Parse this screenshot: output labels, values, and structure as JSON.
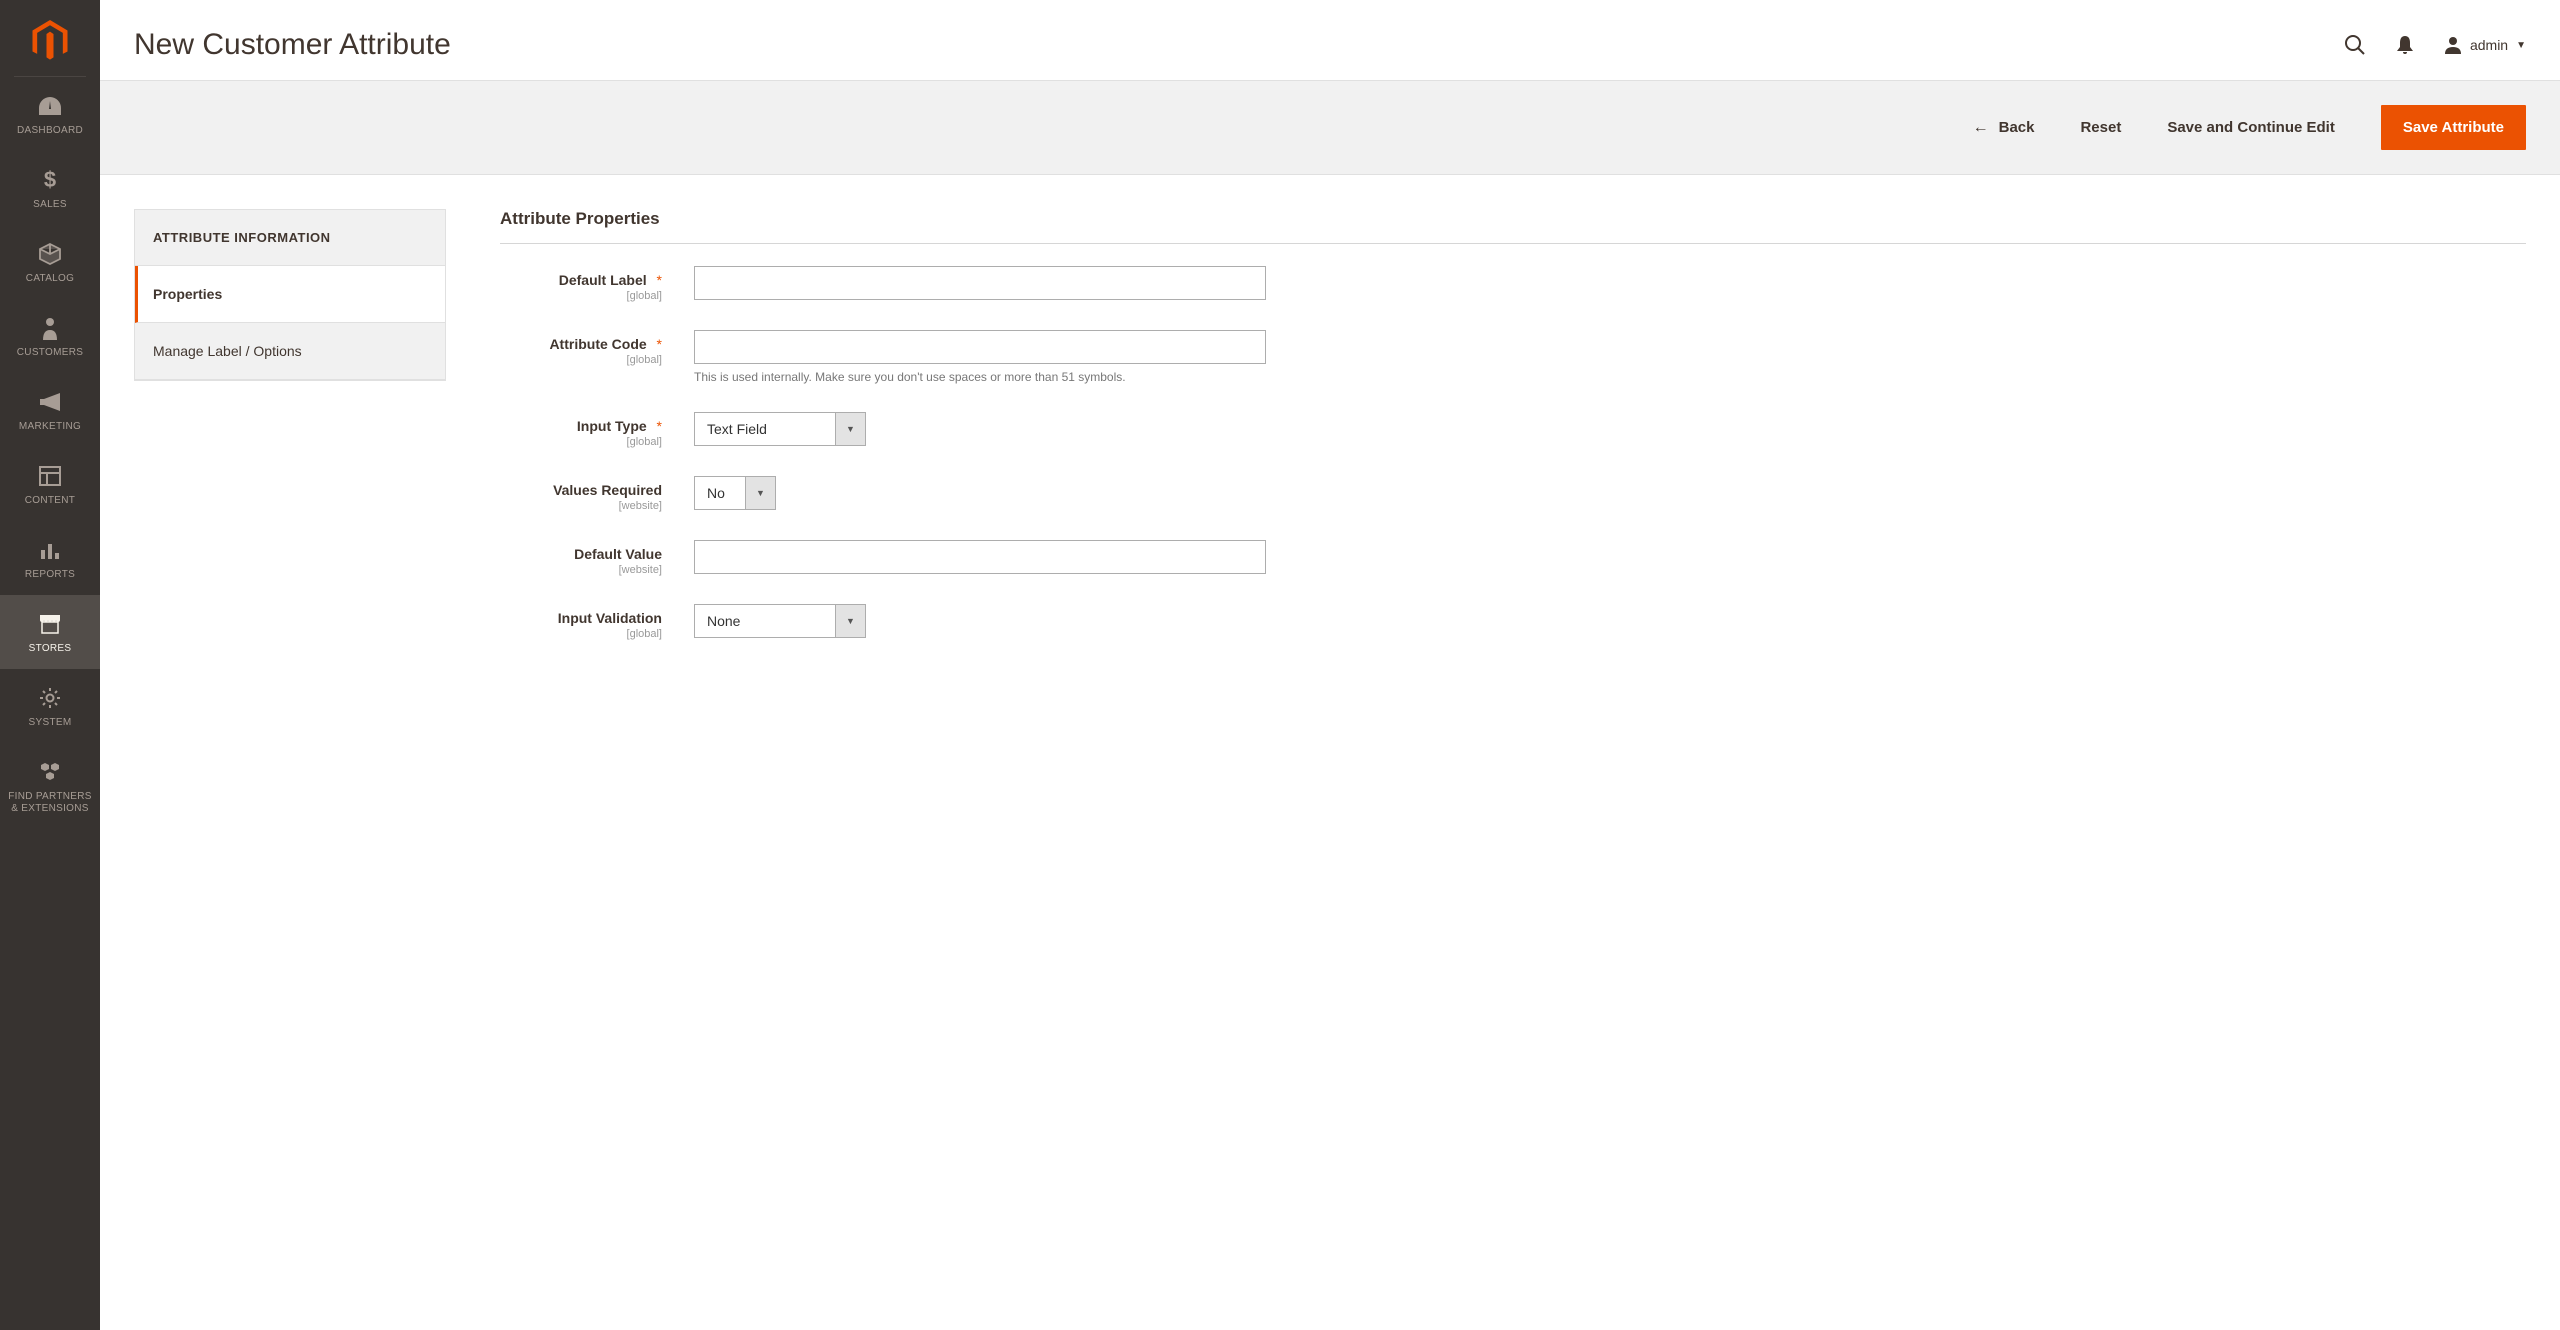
{
  "sidebar": {
    "items": [
      {
        "label": "DASHBOARD"
      },
      {
        "label": "SALES"
      },
      {
        "label": "CATALOG"
      },
      {
        "label": "CUSTOMERS"
      },
      {
        "label": "MARKETING"
      },
      {
        "label": "CONTENT"
      },
      {
        "label": "REPORTS"
      },
      {
        "label": "STORES"
      },
      {
        "label": "SYSTEM"
      },
      {
        "label": "FIND PARTNERS & EXTENSIONS"
      }
    ]
  },
  "header": {
    "title": "New Customer Attribute",
    "account_label": "admin"
  },
  "actions": {
    "back": "Back",
    "reset": "Reset",
    "save_continue": "Save and Continue Edit",
    "save": "Save Attribute"
  },
  "tabs_panel": {
    "title": "ATTRIBUTE INFORMATION",
    "items": [
      {
        "label": "Properties"
      },
      {
        "label": "Manage Label / Options"
      }
    ]
  },
  "form": {
    "section_title": "Attribute Properties",
    "fields": {
      "default_label": {
        "label": "Default Label",
        "scope": "[global]",
        "value": ""
      },
      "attribute_code": {
        "label": "Attribute Code",
        "scope": "[global]",
        "value": "",
        "note": "This is used internally. Make sure you don't use spaces or more than 51 symbols."
      },
      "input_type": {
        "label": "Input Type",
        "scope": "[global]",
        "value": "Text Field"
      },
      "values_required": {
        "label": "Values Required",
        "scope": "[website]",
        "value": "No"
      },
      "default_value": {
        "label": "Default Value",
        "scope": "[website]",
        "value": ""
      },
      "input_validation": {
        "label": "Input Validation",
        "scope": "[global]",
        "value": "None"
      }
    }
  }
}
